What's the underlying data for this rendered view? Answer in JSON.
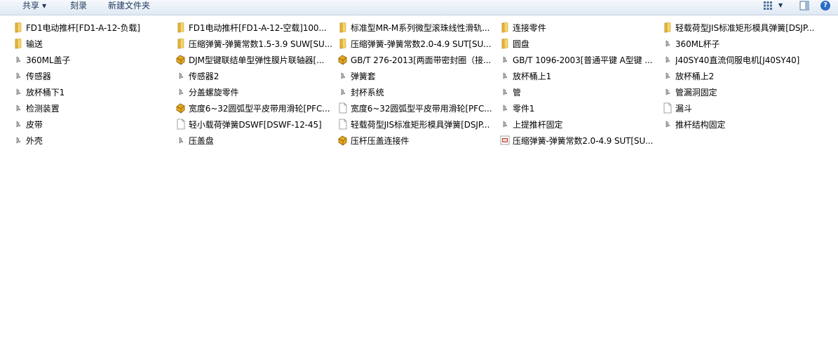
{
  "toolbar": {
    "share_label": "共享",
    "burn_label": "刻录",
    "new_folder_label": "新建文件夹"
  },
  "items": [
    {
      "label": "FD1电动推杆[FD1-A-12-负载]",
      "icon": "folder-icon"
    },
    {
      "label": "输送",
      "icon": "folder-icon"
    },
    {
      "label": "360ML盖子",
      "icon": "part-icon"
    },
    {
      "label": "传感器",
      "icon": "part-icon"
    },
    {
      "label": "放杯桶下1",
      "icon": "part-icon"
    },
    {
      "label": "检测装置",
      "icon": "part-icon"
    },
    {
      "label": "皮带",
      "icon": "part-icon"
    },
    {
      "label": "外壳",
      "icon": "part-icon"
    },
    {
      "label": "FD1电动推杆[FD1-A-12-空载]100...",
      "icon": "folder-icon"
    },
    {
      "label": "压缩弹簧-弹簧常数1.5-3.9 SUW[SU...",
      "icon": "folder-icon"
    },
    {
      "label": "DJM型键联结单型弹性膜片联轴器[...",
      "icon": "assembly-icon"
    },
    {
      "label": "传感器2",
      "icon": "part-icon"
    },
    {
      "label": "分盖螺旋零件",
      "icon": "part-icon"
    },
    {
      "label": "宽度6~32圆弧型平皮带用滑轮[PFC...",
      "icon": "assembly-icon"
    },
    {
      "label": "轻小载荷弹簧DSWF[DSWF-12-45]",
      "icon": "document-icon"
    },
    {
      "label": "压盖盘",
      "icon": "part-icon"
    },
    {
      "label": "标准型MR-M系列微型滚珠线性滑轨...",
      "icon": "folder-icon"
    },
    {
      "label": "压缩弹簧-弹簧常数2.0-4.9 SUT[SU...",
      "icon": "folder-icon"
    },
    {
      "label": "GB/T 276-2013[两面带密封圈（接...",
      "icon": "assembly-icon"
    },
    {
      "label": "弹簧套",
      "icon": "part-icon"
    },
    {
      "label": "封杯系统",
      "icon": "part-icon"
    },
    {
      "label": "宽度6~32圆弧型平皮带用滑轮[PFC...",
      "icon": "document-icon"
    },
    {
      "label": "轻载荷型JIS标准矩形模具弹簧[DSJP...",
      "icon": "document-icon"
    },
    {
      "label": "压杆压盖连接件",
      "icon": "assembly-icon"
    },
    {
      "label": "连接零件",
      "icon": "folder-icon"
    },
    {
      "label": "圆盘",
      "icon": "folder-icon"
    },
    {
      "label": "GB/T 1096-2003[普通平键 A型键 ...",
      "icon": "part-icon"
    },
    {
      "label": "放杯桶上1",
      "icon": "part-icon"
    },
    {
      "label": "管",
      "icon": "part-icon"
    },
    {
      "label": "零件1",
      "icon": "part-icon"
    },
    {
      "label": "上提推杆固定",
      "icon": "part-icon"
    },
    {
      "label": "压缩弹簧-弹簧常数2.0-4.9 SUT[SU...",
      "icon": "drawing-icon"
    },
    {
      "label": "轻载荷型JIS标准矩形模具弹簧[DSJP...",
      "icon": "folder-icon"
    },
    {
      "label": "360ML杯子",
      "icon": "part-icon"
    },
    {
      "label": "J40SY40直流伺服电机[J40SY40]",
      "icon": "part-icon"
    },
    {
      "label": "放杯桶上2",
      "icon": "part-icon"
    },
    {
      "label": "管漏洞固定",
      "icon": "part-icon"
    },
    {
      "label": "漏斗",
      "icon": "document-icon"
    },
    {
      "label": "推杆结构固定",
      "icon": "part-icon"
    }
  ],
  "colors": {
    "folder": "#e8b93a",
    "assembly": "#e5a91f",
    "toolbar_text": "#1e395b"
  }
}
